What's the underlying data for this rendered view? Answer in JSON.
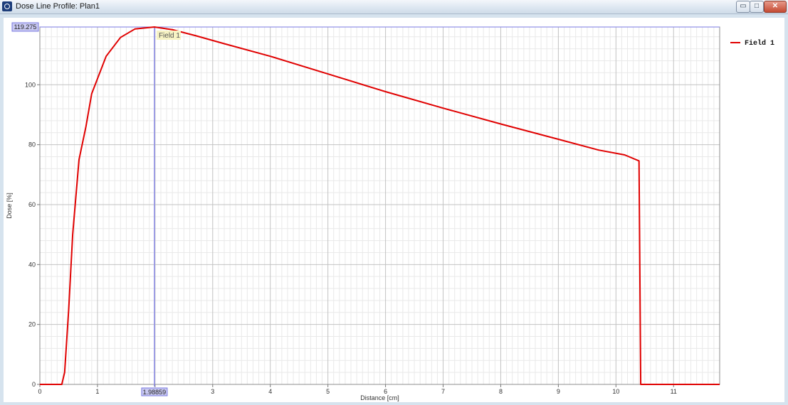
{
  "window": {
    "title": "Dose Line Profile: Plan1",
    "buttons": {
      "minimize": "▭",
      "maximize": "□",
      "close": "✕"
    }
  },
  "chart_data": {
    "type": "line",
    "xlabel": "Distance [cm]",
    "ylabel": "Dose [%]",
    "xlim": [
      0,
      11.8
    ],
    "ylim": [
      0,
      119.275
    ],
    "x_ticks": [
      0,
      1,
      2,
      3,
      4,
      5,
      6,
      7,
      8,
      9,
      10,
      11
    ],
    "y_ticks": [
      0,
      20,
      40,
      60,
      80,
      100
    ],
    "y_max_label": "119.275",
    "grid": true,
    "legend_position": "right",
    "series": [
      {
        "name": "Field 1",
        "color": "#e00000",
        "points": [
          [
            0,
            0
          ],
          [
            0.38,
            0
          ],
          [
            0.43,
            4
          ],
          [
            0.5,
            25
          ],
          [
            0.57,
            50
          ],
          [
            0.68,
            75
          ],
          [
            0.8,
            86
          ],
          [
            0.9,
            97
          ],
          [
            1.15,
            109.5
          ],
          [
            1.4,
            115.8
          ],
          [
            1.65,
            118.6
          ],
          [
            1.98859,
            119.275
          ],
          [
            2.3,
            118.4
          ],
          [
            2.7,
            116.4
          ],
          [
            3.2,
            113.7
          ],
          [
            4,
            109.5
          ],
          [
            5,
            103.6
          ],
          [
            6,
            97.7
          ],
          [
            7,
            92.2
          ],
          [
            8,
            86.9
          ],
          [
            9,
            81.8
          ],
          [
            9.7,
            78.2
          ],
          [
            10.15,
            76.6
          ],
          [
            10.4,
            74.6
          ],
          [
            10.43,
            0
          ],
          [
            11.8,
            0
          ]
        ]
      }
    ],
    "cursor": {
      "x": 1.98859,
      "x_label": "1.98859",
      "tooltip": "Field 1"
    }
  }
}
